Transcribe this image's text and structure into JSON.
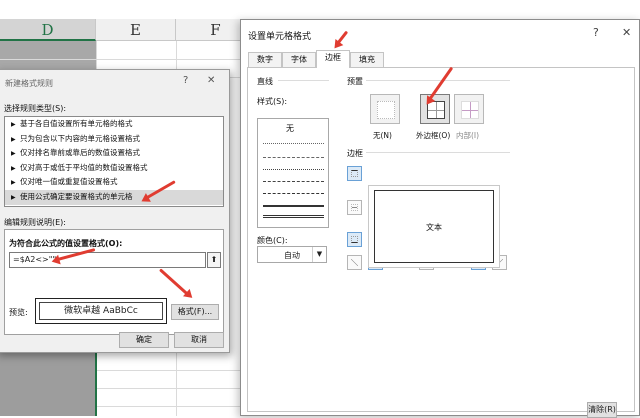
{
  "excel": {
    "columns": [
      "D",
      "E",
      "F"
    ]
  },
  "rule_dialog": {
    "title": "新建格式规则",
    "help": "?",
    "close": "✕",
    "select_type_label": "选择规则类型(S):",
    "rule_types": [
      "基于各自值设置所有单元格的格式",
      "只为包含以下内容的单元格设置格式",
      "仅对排名靠前或靠后的数值设置格式",
      "仅对高于或低于平均值的数值设置格式",
      "仅对唯一值或重复值设置格式",
      "使用公式确定要设置格式的单元格"
    ],
    "selected_rule_index": 5,
    "edit_desc_label": "编辑规则说明(E):",
    "formula_label": "为符合此公式的值设置格式(O):",
    "formula_value": "=$A2<>\"\"",
    "ref_icon": "⬆",
    "preview_label": "预览:",
    "preview_text": "微软卓越  AaBbCc",
    "format_button": "格式(F)...",
    "ok_button": "确定",
    "cancel_button": "取消"
  },
  "format_dialog": {
    "title": "设置单元格格式",
    "help": "?",
    "close": "✕",
    "tabs": [
      "数字",
      "字体",
      "边框",
      "填充"
    ],
    "active_tab": "边框",
    "line_section": "直线",
    "style_label": "样式(S):",
    "style_none": "无",
    "color_label": "颜色(C):",
    "color_value": "自动",
    "presets_section": "预置",
    "presets": [
      {
        "label": "无(N)"
      },
      {
        "label": "外边框(O)"
      },
      {
        "label": "内部(I)"
      }
    ],
    "border_section": "边框",
    "preview_text": "文本",
    "clear_button": "清除(R)"
  },
  "colors": {
    "arrow": "#e03c31",
    "excel_green": "#217346"
  }
}
